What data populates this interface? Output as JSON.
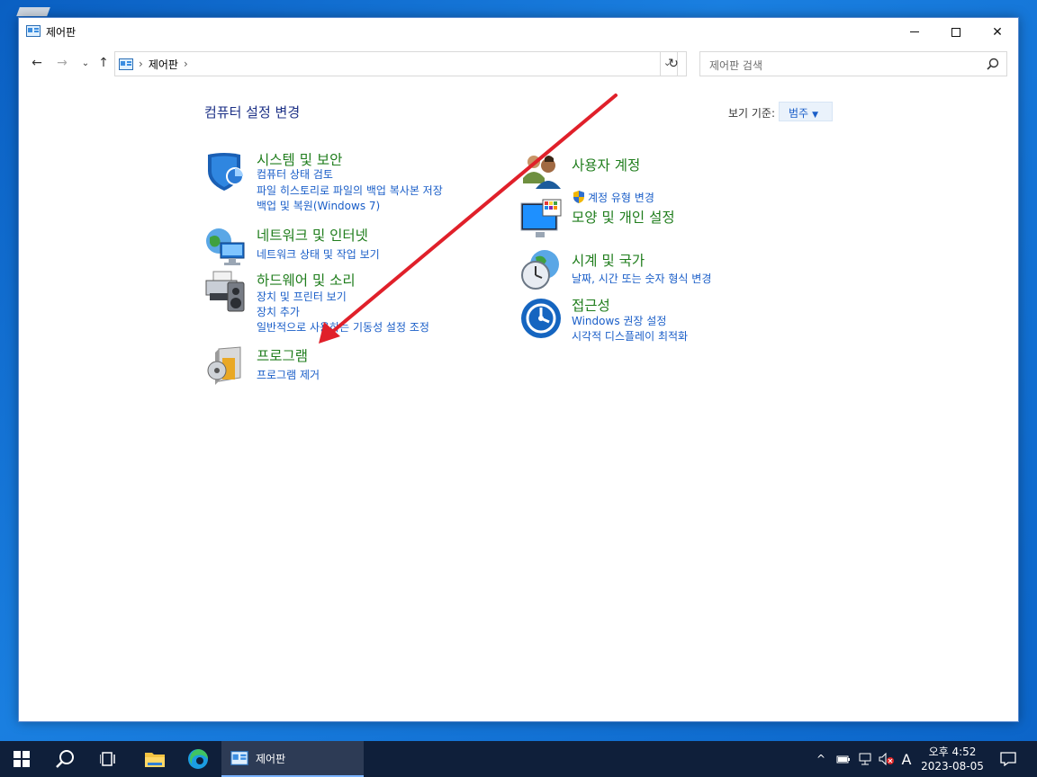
{
  "window": {
    "title": "제어판"
  },
  "navbar": {
    "breadcrumb": "제어판",
    "search_placeholder": "제어판 검색"
  },
  "content": {
    "heading": "컴퓨터 설정 변경",
    "viewby_label": "보기 기준:",
    "viewby_value": "범주"
  },
  "categories": {
    "system": {
      "title": "시스템 및 보안",
      "links": [
        "컴퓨터 상태 검토",
        "파일 히스토리로 파일의 백업 복사본 저장",
        "백업 및 복원(Windows 7)"
      ]
    },
    "network": {
      "title": "네트워크 및 인터넷",
      "links": [
        "네트워크 상태 및 작업 보기"
      ]
    },
    "hardware": {
      "title": "하드웨어 및 소리",
      "links": [
        "장치 및 프린터 보기",
        "장치 추가",
        "일반적으로 사용하는 기동성 설정 조정"
      ]
    },
    "programs": {
      "title": "프로그램",
      "links": [
        "프로그램 제거"
      ]
    },
    "users": {
      "title": "사용자 계정",
      "links": [
        "계정 유형 변경"
      ]
    },
    "appearance": {
      "title": "모양 및 개인 설정",
      "links": []
    },
    "clock": {
      "title": "시계 및 국가",
      "links": [
        "날짜, 시간 또는 숫자 형식 변경"
      ]
    },
    "access": {
      "title": "접근성",
      "links": [
        "Windows 권장 설정",
        "시각적 디스플레이 최적화"
      ]
    }
  },
  "taskbar": {
    "active_app": "제어판",
    "ime": "A",
    "time": "오후 4:52",
    "date": "2023-08-05"
  },
  "colors": {
    "category_title": "#1f7d1c",
    "link": "#1a5ec8",
    "heading": "#1e3287",
    "annotation_arrow": "#e0202a"
  }
}
